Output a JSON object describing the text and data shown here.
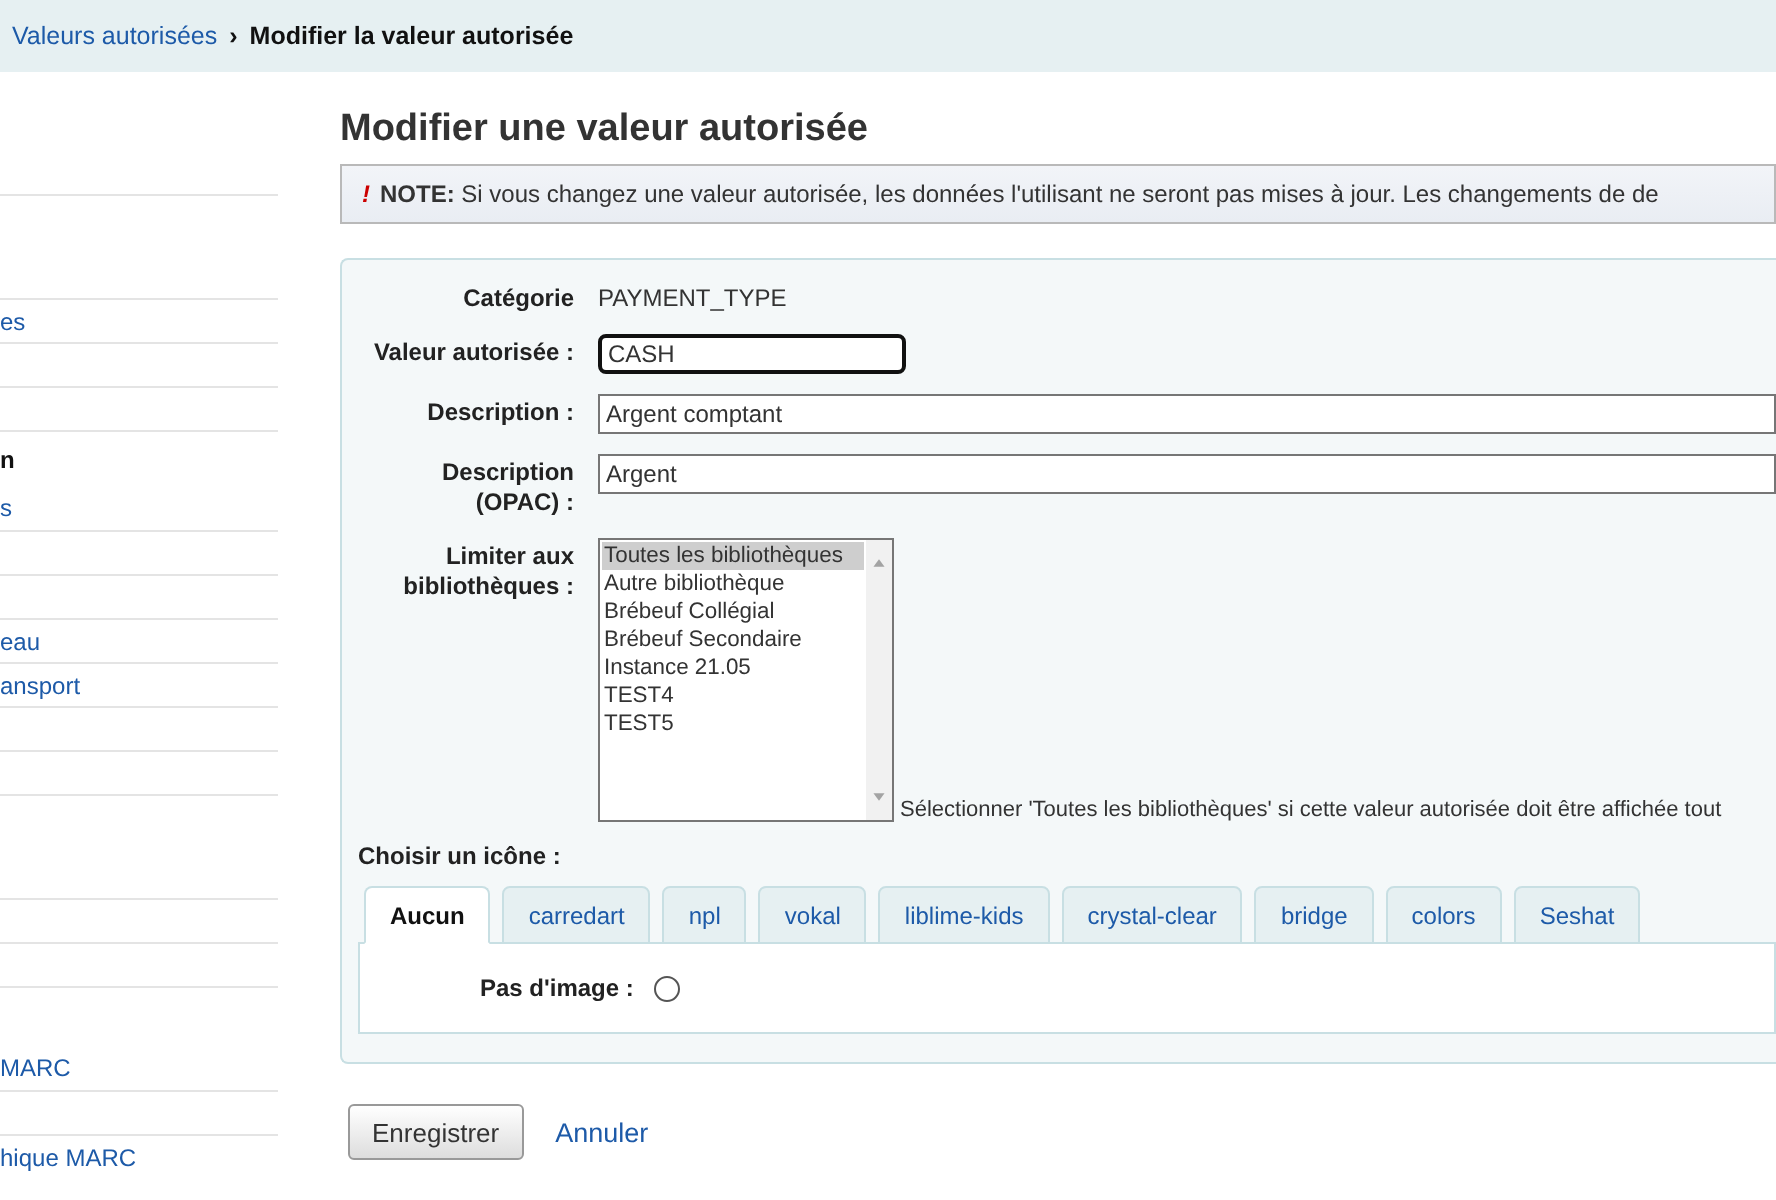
{
  "breadcrumb": {
    "separator": "›",
    "items": [
      {
        "label": "Valeurs autorisées",
        "kind": "link"
      },
      {
        "label": "Modifier la valeur autorisée",
        "kind": "current"
      }
    ]
  },
  "sidebar": {
    "rows": [
      {
        "kind": "spacer"
      },
      {
        "kind": "link",
        "label": "es"
      },
      {
        "kind": "link"
      },
      {
        "kind": "link"
      },
      {
        "kind": "heading",
        "label": "n"
      },
      {
        "kind": "link",
        "label": "s"
      },
      {
        "kind": "link"
      },
      {
        "kind": "link"
      },
      {
        "kind": "link",
        "label": "eau"
      },
      {
        "kind": "link",
        "label": "ansport"
      },
      {
        "kind": "link"
      },
      {
        "kind": "link"
      },
      {
        "kind": "spacer"
      },
      {
        "kind": "link"
      },
      {
        "kind": "link"
      },
      {
        "kind": "spacer",
        "label": "MARC"
      },
      {
        "kind": "link"
      },
      {
        "kind": "link",
        "label": "hique MARC"
      }
    ]
  },
  "title": "Modifier une valeur autorisée",
  "note": {
    "mark": "!",
    "text": "**NOTE:** Si vous changez une valeur autorisée, les données l'utilisant ne seront pas mises à jour. Les changements de de"
  },
  "form": {
    "fields": [
      {
        "kind": "static",
        "label": "Catégorie",
        "value": "PAYMENT_TYPE"
      },
      {
        "kind": "short",
        "label": "Valeur autorisée :",
        "value": "CASH"
      },
      {
        "kind": "wide",
        "label": "Description :",
        "value": "Argent comptant"
      },
      {
        "kind": "wide",
        "label": "Description (OPAC) :",
        "value": "Argent"
      },
      {
        "kind": "list",
        "label": "Limiter aux bibliothèques :",
        "hint": "Sélectionner 'Toutes les bibliothèques' si cette valeur autorisée doit être affichée tout",
        "options": [
          {
            "label": "Toutes les bibliothèques",
            "selected": true
          },
          {
            "label": "Autre bibliothèque",
            "selected": false
          },
          {
            "label": "Brébeuf Collégial",
            "selected": false
          },
          {
            "label": "Brébeuf Secondaire",
            "selected": false
          },
          {
            "label": "Instance 21.05",
            "selected": false
          },
          {
            "label": "TEST4",
            "selected": false
          },
          {
            "label": "TEST5",
            "selected": false
          }
        ]
      }
    ],
    "icon_label": "Choisir un icône :",
    "tabs": [
      {
        "label": "Aucun",
        "selected": true
      },
      {
        "label": "carredart",
        "selected": false
      },
      {
        "label": "npl",
        "selected": false
      },
      {
        "label": "vokal",
        "selected": false
      },
      {
        "label": "liblime-kids",
        "selected": false
      },
      {
        "label": "crystal-clear",
        "selected": false
      },
      {
        "label": "bridge",
        "selected": false
      },
      {
        "label": "colors",
        "selected": false
      },
      {
        "label": "Seshat",
        "selected": false
      }
    ],
    "no_image": {
      "label": "Pas d'image :",
      "checked": false
    }
  },
  "actions": {
    "save": "Enregistrer",
    "cancel": "Annuler"
  }
}
